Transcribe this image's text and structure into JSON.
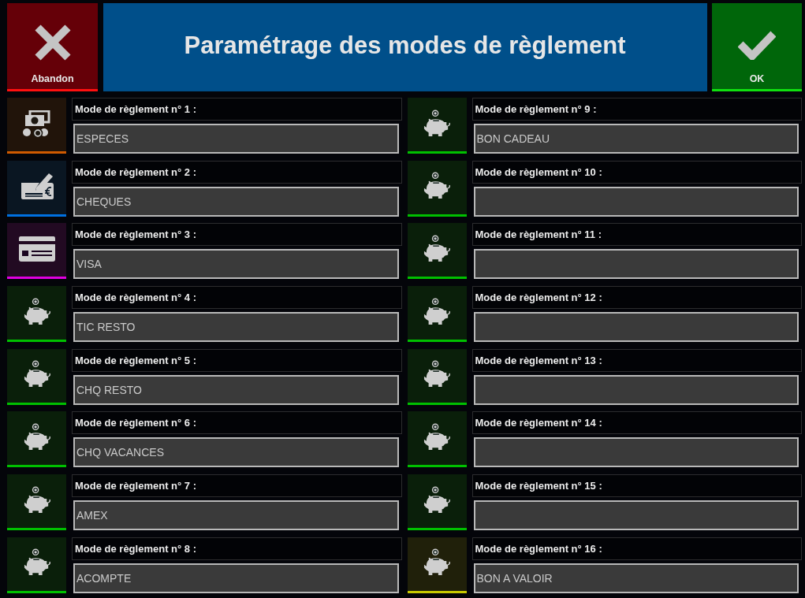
{
  "header": {
    "cancel_button": {
      "label": "Abandon"
    },
    "title": "Paramétrage des modes de règlement",
    "ok_button": {
      "label": "OK"
    }
  },
  "payment_modes": [
    {
      "label": "Mode de règlement n° 1 :",
      "value": "ESPECES",
      "kind": "cash",
      "color": "#d05a00"
    },
    {
      "label": "Mode de règlement n° 2 :",
      "value": "CHEQUES",
      "kind": "cheque",
      "color": "#0070e0"
    },
    {
      "label": "Mode de règlement n° 3 :",
      "value": "VISA",
      "kind": "card",
      "color": "#e000e0"
    },
    {
      "label": "Mode de règlement n° 4 :",
      "value": "TIC RESTO",
      "kind": "piggy",
      "color": "#00c000"
    },
    {
      "label": "Mode de règlement n° 5 :",
      "value": "CHQ RESTO",
      "kind": "piggy",
      "color": "#00c000"
    },
    {
      "label": "Mode de règlement n° 6 :",
      "value": "CHQ VACANCES",
      "kind": "piggy",
      "color": "#00c000"
    },
    {
      "label": "Mode de règlement n° 7 :",
      "value": "AMEX",
      "kind": "piggy",
      "color": "#00c000"
    },
    {
      "label": "Mode de règlement n° 8 :",
      "value": "ACOMPTE",
      "kind": "piggy",
      "color": "#00c000"
    },
    {
      "label": "Mode de règlement n° 9 :",
      "value": "BON CADEAU",
      "kind": "piggy",
      "color": "#00c000"
    },
    {
      "label": "Mode de règlement n° 10 :",
      "kind": "piggy",
      "color": "#00c000"
    },
    {
      "label": "Mode de règlement n° 11 :",
      "kind": "piggy",
      "color": "#00c000"
    },
    {
      "label": "Mode de règlement n° 12 :",
      "kind": "piggy",
      "color": "#00c000"
    },
    {
      "label": "Mode de règlement n° 13 :",
      "kind": "piggy",
      "color": "#00c000"
    },
    {
      "label": "Mode de règlement n° 14 :",
      "kind": "piggy",
      "color": "#00c000"
    },
    {
      "label": "Mode de règlement n° 15 :",
      "kind": "piggy",
      "color": "#00c000"
    },
    {
      "label": "Mode de règlement n° 16 :",
      "value": "BON A VALOIR",
      "kind": "piggy",
      "color": "#c8c800"
    }
  ]
}
